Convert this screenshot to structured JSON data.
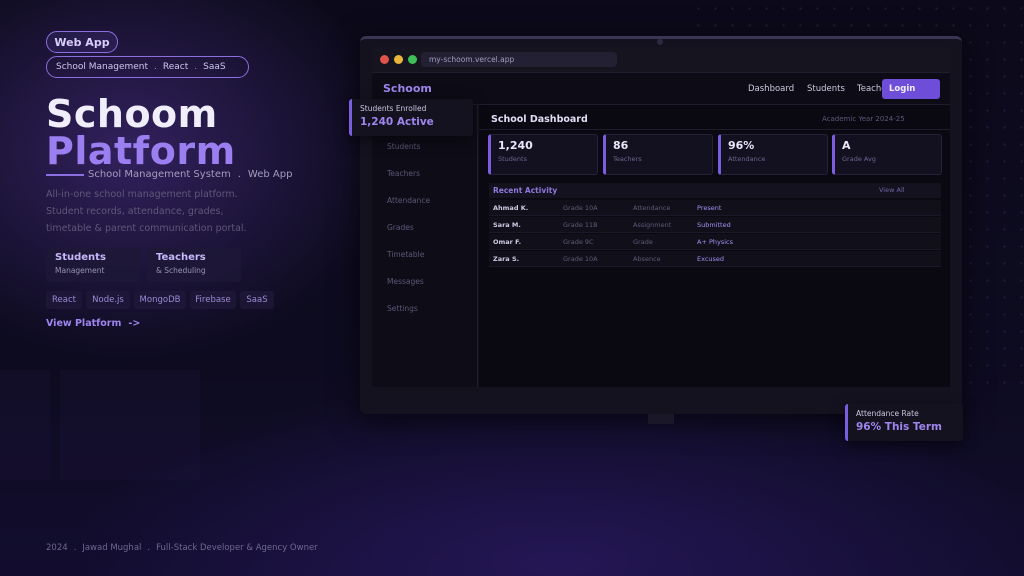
{
  "hero": {
    "badge": "Web App",
    "tags": [
      "School Management",
      "React",
      "SaaS"
    ],
    "tag_separator": ".",
    "title_line1": "Schoom",
    "title_line2": "Platform",
    "subtitle": "School Management System",
    "subtitle_sep": ".",
    "subtitle_type": "Web App",
    "description": [
      "All-in-one school management platform.",
      "Student records, attendance, grades,",
      "timetable & parent communication portal."
    ],
    "features": [
      {
        "title": "Students",
        "sub": "Management"
      },
      {
        "title": "Teachers",
        "sub": "& Scheduling"
      }
    ],
    "tech": [
      "React",
      "Node.js",
      "MongoDB",
      "Firebase",
      "SaaS"
    ],
    "cta": "View Platform",
    "cta_arrow": "->"
  },
  "footer": {
    "year": "2024",
    "name": "Jawad Mughal",
    "role": "Full-Stack Developer & Agency Owner",
    "sep": "."
  },
  "browser": {
    "url": "my-schoom.vercel.app",
    "dot_colors": [
      "#e0524a",
      "#e8b63a",
      "#3fbf57"
    ]
  },
  "app": {
    "brand": "Schoom",
    "nav": [
      "Dashboard",
      "Students",
      "Teache"
    ],
    "login": "Login",
    "sidebar": [
      "Students",
      "Teachers",
      "Attendance",
      "Grades",
      "Timetable",
      "Messages",
      "Settings"
    ],
    "dashboard_title": "School Dashboard",
    "academic_year": "Academic Year 2024-25",
    "stats": [
      {
        "value": "1,240",
        "label": "Students"
      },
      {
        "value": "86",
        "label": "Teachers"
      },
      {
        "value": "96%",
        "label": "Attendance"
      },
      {
        "value": "A",
        "label": "Grade Avg"
      }
    ],
    "recent_activity": "Recent Activity",
    "view_all": "View All",
    "activity": [
      {
        "name": "Ahmad K.",
        "grade": "Grade 10A",
        "type": "Attendance",
        "status": "Present"
      },
      {
        "name": "Sara M.",
        "grade": "Grade 11B",
        "type": "Assignment",
        "status": "Submitted"
      },
      {
        "name": "Omar F.",
        "grade": "Grade 9C",
        "type": "Grade",
        "status": "A+ Physics"
      },
      {
        "name": "Zara S.",
        "grade": "Grade 10A",
        "type": "Absence",
        "status": "Excused"
      }
    ]
  },
  "cards": {
    "enrolled": {
      "label": "Students Enrolled",
      "value": "1,240 Active"
    },
    "attendance": {
      "label": "Attendance Rate",
      "value": "96% This Term"
    }
  },
  "colors": {
    "accent": "#9f86ee",
    "accent_strong": "#6e4ed8",
    "background": "#0c0a1a"
  }
}
